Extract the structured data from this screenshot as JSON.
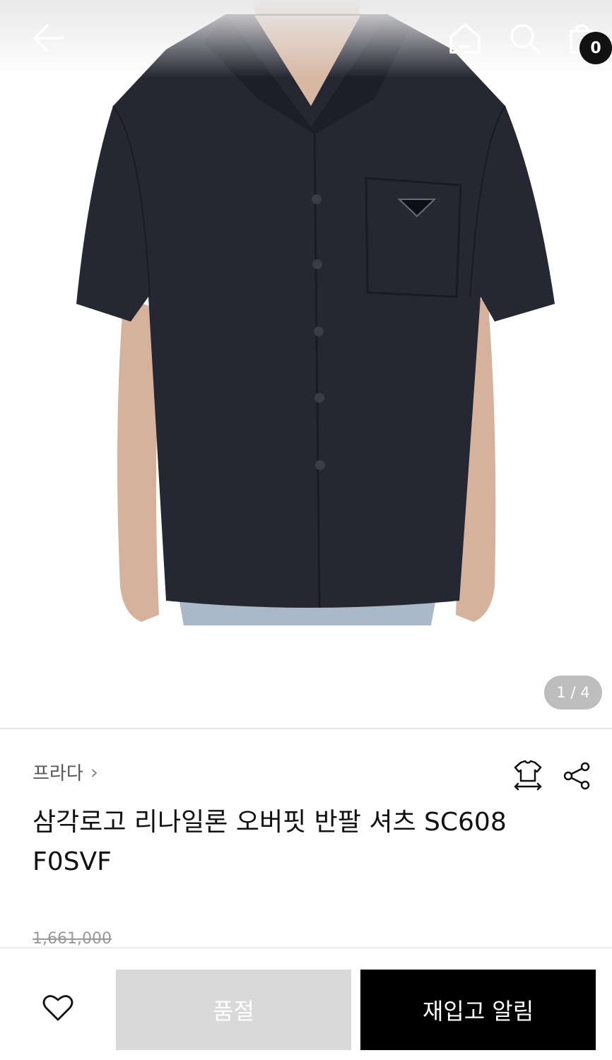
{
  "header": {
    "cart_count": "0",
    "icons": [
      "back-arrow-icon",
      "home-icon",
      "search-icon",
      "shopping-bag-icon"
    ]
  },
  "gallery": {
    "indicator": "1 / 4",
    "image_subject": "shirt-photo"
  },
  "product": {
    "brand": "프라다",
    "title": "삼각로고 리나일론 오버핏 반팔 셔츠 SC608 F0SVF",
    "original_price": "1,661,000"
  },
  "actions": {
    "soldout_label": "품절",
    "restock_label": "재입고 알림"
  },
  "colors": {
    "accent": "#000000",
    "soldout_bg": "#d9d9d9",
    "indicator_bg": "#bdbdbd"
  }
}
